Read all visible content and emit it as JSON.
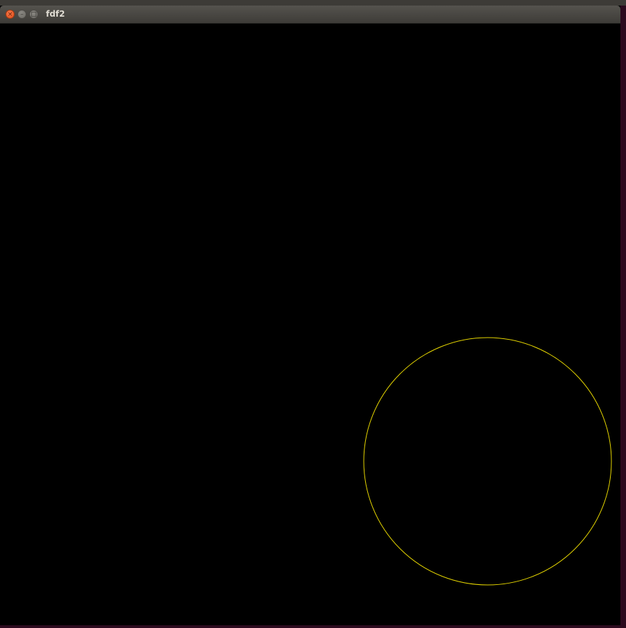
{
  "window": {
    "title": "fdf2",
    "controls": {
      "close_glyph": "×",
      "minimize_glyph": "–",
      "maximize_glyph": "□"
    }
  },
  "canvas": {
    "background": "#000000",
    "shape": {
      "type": "circle",
      "stroke_color": "#e6d600"
    }
  }
}
